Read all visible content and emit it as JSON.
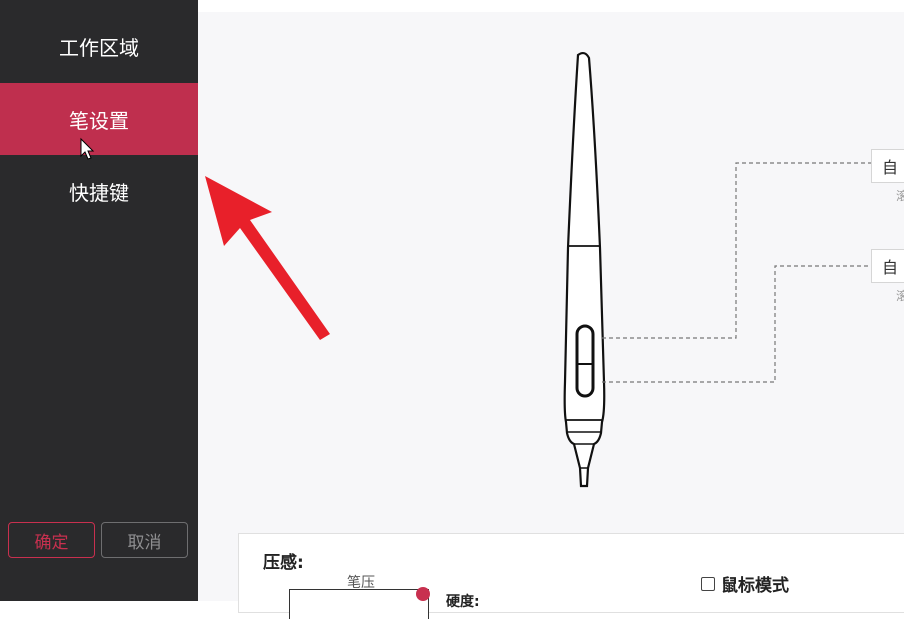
{
  "sidebar": {
    "items": [
      {
        "label": "工作区域",
        "active": false
      },
      {
        "label": "笔设置",
        "active": true
      },
      {
        "label": "快捷键",
        "active": false
      }
    ],
    "confirm_label": "确定",
    "cancel_label": "取消"
  },
  "pen": {
    "button_upper_label": "自",
    "button_upper_sub": "滚",
    "button_lower_label": "自",
    "button_lower_sub": "滚"
  },
  "pressure": {
    "title": "压感:",
    "curve_label": "笔压",
    "hardness_label": "硬度:",
    "mouse_mode_label": "鼠标模式",
    "mouse_mode_checked": false
  },
  "colors": {
    "accent": "#bf2f4e",
    "sidebar_bg": "#2a2a2c",
    "annotation_arrow": "#e8202a"
  }
}
